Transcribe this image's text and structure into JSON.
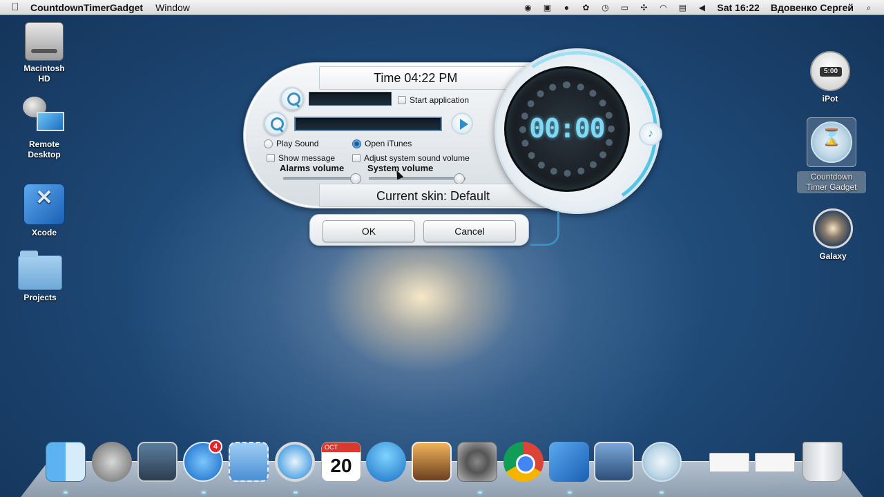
{
  "menubar": {
    "app_name": "CountdownTimerGadget",
    "menus": [
      "Window"
    ],
    "clock": "Sat 16:22",
    "user": "Вдовенко Сергей"
  },
  "desktop": {
    "icons": [
      {
        "label": "Macintosh HD"
      },
      {
        "label": "Remote Desktop"
      },
      {
        "label": "Xcode"
      },
      {
        "label": "Projects"
      },
      {
        "label": "iPot",
        "display": "5:00"
      },
      {
        "label": "Countdown Timer Gadget"
      },
      {
        "label": "Galaxy"
      }
    ]
  },
  "gadget": {
    "time_title": "Time 04:22 PM",
    "start_application_label": "Start application",
    "play_sound_label": "Play Sound",
    "open_itunes_label": "Open iTunes",
    "show_message_label": "Show message",
    "adjust_volume_label": "Adjust system sound volume",
    "alarms_volume_label": "Alarms volume",
    "system_volume_label": "System volume",
    "skin_label": "Current skin: Default",
    "countdown_display": "00:00",
    "ok_label": "OK",
    "cancel_label": "Cancel",
    "selected_action": "Open iTunes",
    "alarms_volume_level": 0.9,
    "system_volume_level": 0.8,
    "accent_color": "#55c6e6"
  },
  "dock": {
    "app_store_badge": "4",
    "calendar_month": "OCT",
    "calendar_day": "20",
    "items": [
      "finder-icon",
      "launchpad-icon",
      "gallery-icon",
      "app-store-icon",
      "mail-icon",
      "safari-icon",
      "calendar-icon",
      "itunes-icon",
      "iphoto-icon",
      "system-preferences-icon",
      "chrome-icon",
      "xcode-icon",
      "media-icon",
      "countdown-timer-icon",
      "stack-icon",
      "stack-icon",
      "trash-icon"
    ]
  }
}
